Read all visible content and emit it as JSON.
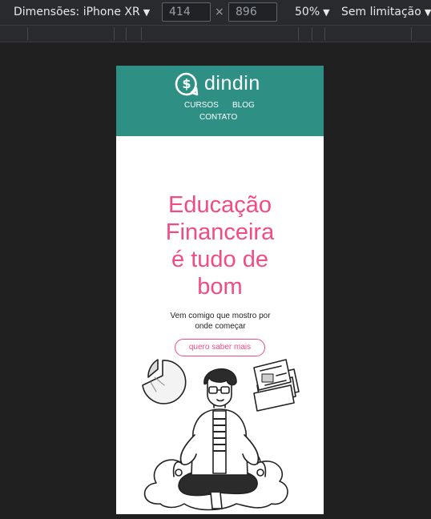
{
  "devtools": {
    "dimensions_label": "Dimensões: iPhone XR",
    "width_value": "414",
    "height_value": "896",
    "separator": "×",
    "zoom_label": "50%",
    "throttle_label": "Sem limitação",
    "dropdown_arrow": "▼"
  },
  "site": {
    "brand": "dindin",
    "logo_symbol": "$",
    "nav": [
      {
        "label": "CURSOS"
      },
      {
        "label": "BLOG"
      },
      {
        "label": "CONTATO"
      }
    ],
    "hero": {
      "title_lines": [
        "Educação",
        "Financeira",
        "é tudo de",
        "bom"
      ],
      "subtitle_lines": [
        "Vem comigo que mostro por",
        "onde começar"
      ],
      "cta_label": "quero saber mais"
    },
    "colors": {
      "header_bg": "#2e9084",
      "accent_pink": "#f24b85",
      "devtools_bg": "#292a2d",
      "canvas_bg": "#202020"
    },
    "illustration": "person-meditating-on-cloud-with-pie-chart-and-money"
  }
}
